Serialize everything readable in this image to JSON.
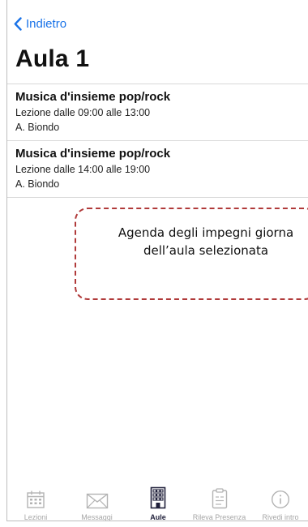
{
  "nav": {
    "back_label": "Indietro"
  },
  "page": {
    "title": "Aula 1"
  },
  "events": [
    {
      "title": "Musica d'insieme pop/rock",
      "time": "Lezione dalle 09:00 alle 13:00",
      "teacher": "A. Biondo"
    },
    {
      "title": "Musica d'insieme pop/rock",
      "time": "Lezione dalle 14:00 alle 19:00",
      "teacher": "A. Biondo"
    }
  ],
  "annotation": {
    "line1": "Agenda degli impegni giorna",
    "line2": "dell’aula selezionata"
  },
  "tabbar": {
    "items": [
      {
        "label": "Lezioni",
        "icon": "calendar-icon",
        "active": false
      },
      {
        "label": "Messaggi",
        "icon": "envelope-icon",
        "active": false
      },
      {
        "label": "Aule",
        "icon": "building-icon",
        "active": true
      },
      {
        "label": "Rileva Presenza",
        "icon": "clipboard-icon",
        "active": false
      },
      {
        "label": "Rivedi intro",
        "icon": "info-icon",
        "active": false
      }
    ]
  },
  "colors": {
    "accent": "#1a73e8",
    "callout_border": "#b03a3a",
    "tab_active": "#1f1f3a",
    "tab_inactive": "#b3b3b3"
  }
}
